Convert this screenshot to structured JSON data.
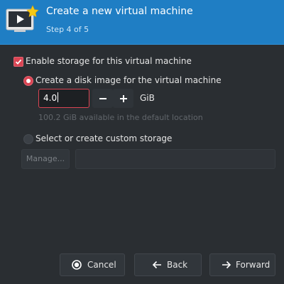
{
  "header": {
    "title": "Create a new virtual machine",
    "step": "Step 4 of 5",
    "icon": "new-vm-icon"
  },
  "storage": {
    "enable_label": "Enable storage for this virtual machine",
    "enable_checked": true,
    "create_disk_label": "Create a disk image for the virtual machine",
    "create_disk_selected": true,
    "size_value": "4.0",
    "size_unit": "GiB",
    "available_text": "100.2 GiB available in the default location",
    "custom_label": "Select or create custom storage",
    "custom_selected": false,
    "manage_label": "Manage...",
    "custom_path_value": ""
  },
  "buttons": {
    "cancel": "Cancel",
    "back": "Back",
    "forward": "Forward"
  },
  "colors": {
    "header_bg": "#1f7ec4",
    "window_bg": "#2a2e32",
    "accent": "#da4453",
    "button_bg": "#31363b"
  }
}
